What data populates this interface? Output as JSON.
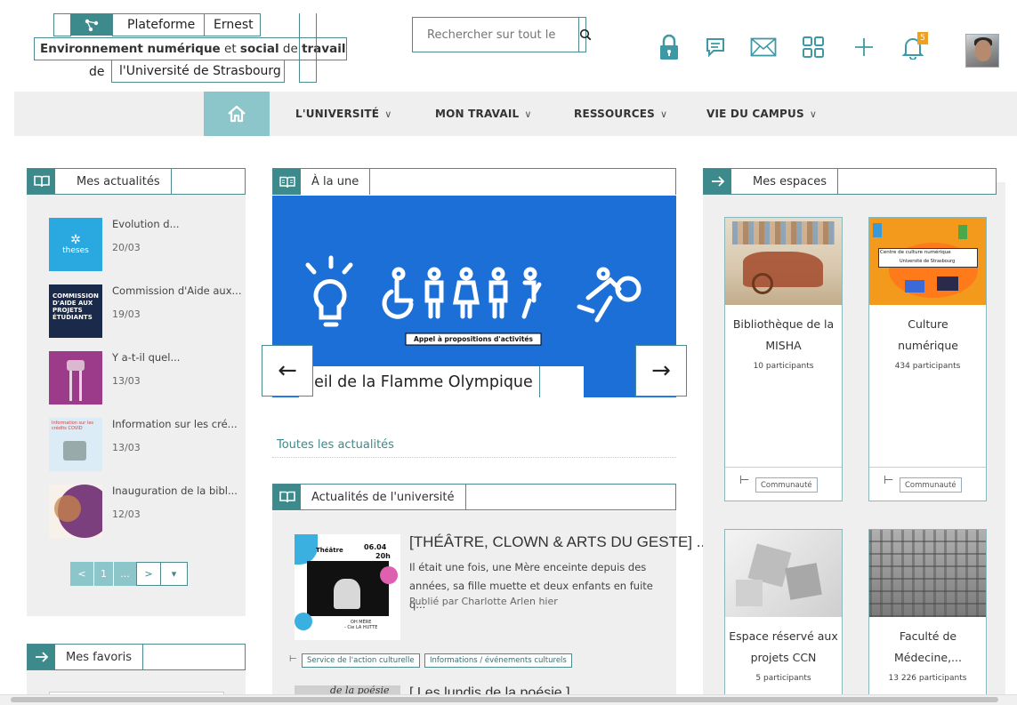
{
  "header": {
    "logo_platform": "Plateforme",
    "logo_name": "Ernest",
    "logo_line2_b1": "Environnement numérique",
    "logo_line2_t1": " et ",
    "logo_line2_b2": "social",
    "logo_line2_t2": " de ",
    "logo_line2_b3": "travail",
    "logo_line3_de": "de",
    "logo_line3_univ": "l'Université de Strasbourg",
    "search_placeholder": "Rechercher sur tout le",
    "notif_count": "5"
  },
  "nav": {
    "items": [
      {
        "label": "L'UNIVERSITÉ"
      },
      {
        "label": "MON TRAVAIL"
      },
      {
        "label": "RESSOURCES"
      },
      {
        "label": "VIE DU CAMPUS"
      }
    ]
  },
  "mes_actualites": {
    "title": "Mes actualités",
    "items": [
      {
        "title": "Evolution d...",
        "date": "20/03",
        "thumb_text": "theses"
      },
      {
        "title": "Commission d'Aide aux...",
        "date": "19/03",
        "thumb_text": "COMMISSION D'AIDE AUX PROJETS ÉTUDIANTS"
      },
      {
        "title": "Y a-t-il quel...",
        "date": "13/03"
      },
      {
        "title": "Information sur les cré...",
        "date": "13/03",
        "thumb_text": "Information sur les crédits COVID"
      },
      {
        "title": "Inauguration de la bibl...",
        "date": "12/03"
      }
    ],
    "pager": {
      "prev": "<",
      "page": "1",
      "more": "...",
      "next": ">",
      "dropdown": "▾"
    }
  },
  "a_la_une": {
    "title": "À la une",
    "banner_label": "Appel à propositions d'activités",
    "caption": "ueil de la Flamme Olympique",
    "prev": "←",
    "next": "→",
    "all_news_link": "Toutes les actualités"
  },
  "actu_univ": {
    "title": "Actualités de l'université",
    "item": {
      "title": "[THÉÂTRE, CLOWN & ARTS DU GESTE] ...",
      "text": "Il était une fois, une Mère enceinte depuis des années, sa fille muette et deux enfants en fuite q...",
      "meta": "Publié par Charlotte Arlen hier",
      "thumb_label": "Théâtre",
      "thumb_date": "06.04",
      "thumb_time": "20h",
      "thumb_caption": "OH MÈRE\n- Cie LA HUTTE",
      "tags": [
        "Service de l'action culturelle",
        "Informations / événements culturels"
      ]
    },
    "item2_title": "[ Les lundis de la poésie ]",
    "item2_thumb_text": "de la poésie"
  },
  "mes_espaces": {
    "title": "Mes espaces",
    "cards": [
      {
        "name": "Bibliothèque de la MISHA",
        "count": "10 participants"
      },
      {
        "name": "Culture numérique",
        "count": "434 participants",
        "tag": "Communauté",
        "img_label1": "Centre de culture numérique",
        "img_label2": "Université de Strasbourg"
      },
      {
        "name": "Espace réservé aux projets CCN",
        "count": "5 participants"
      },
      {
        "name": "Faculté de Médecine,...",
        "count": "13 226 participants"
      }
    ],
    "card1_tag": "Communauté"
  },
  "mes_favoris": {
    "title": "Mes favoris"
  },
  "colors": {
    "teal": "#3d8a8d",
    "teal_light": "#8cc6cb",
    "blue_banner": "#1b6fd6",
    "panel_bg": "#efefef"
  }
}
